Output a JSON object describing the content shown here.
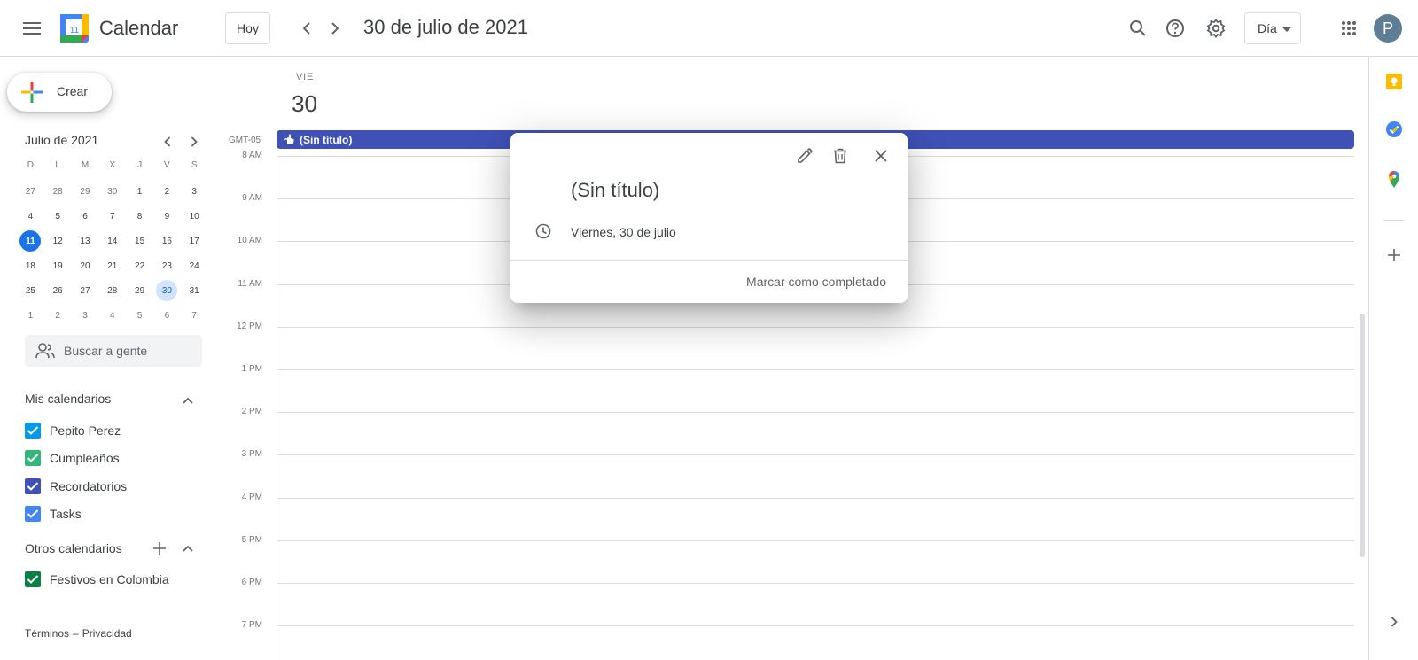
{
  "header": {
    "app_name": "Calendar",
    "logo_day": "11",
    "today_label": "Hoy",
    "date_title": "30 de julio de 2021",
    "view_label": "Día",
    "avatar_letter": "P"
  },
  "sidebar": {
    "create_label": "Crear",
    "mini_calendar": {
      "month_label": "Julio de 2021",
      "weekdays": [
        "D",
        "L",
        "M",
        "X",
        "J",
        "V",
        "S"
      ],
      "weeks": [
        [
          "27",
          "28",
          "29",
          "30",
          "1",
          "2",
          "3"
        ],
        [
          "4",
          "5",
          "6",
          "7",
          "8",
          "9",
          "10"
        ],
        [
          "11",
          "12",
          "13",
          "14",
          "15",
          "16",
          "17"
        ],
        [
          "18",
          "19",
          "20",
          "21",
          "22",
          "23",
          "24"
        ],
        [
          "25",
          "26",
          "27",
          "28",
          "29",
          "30",
          "31"
        ],
        [
          "1",
          "2",
          "3",
          "4",
          "5",
          "6",
          "7"
        ]
      ],
      "today": "11",
      "selected": "30"
    },
    "search_people_placeholder": "Buscar a gente",
    "my_calendars_title": "Mis calendarios",
    "my_calendars": [
      {
        "name": "Pepito Perez",
        "color": "#039be5"
      },
      {
        "name": "Cumpleaños",
        "color": "#33b679"
      },
      {
        "name": "Recordatorios",
        "color": "#3f51b5"
      },
      {
        "name": "Tasks",
        "color": "#4285f4"
      }
    ],
    "other_calendars_title": "Otros calendarios",
    "other_calendars": [
      {
        "name": "Festivos en Colombia",
        "color": "#0b8043"
      }
    ],
    "footer": {
      "terms": "Términos",
      "dash": "–",
      "privacy": "Privacidad"
    }
  },
  "day_view": {
    "day_of_week": "VIE",
    "day_number": "30",
    "timezone": "GMT-05",
    "allday_event": {
      "title": "(Sin título)",
      "color": "#3f51b5"
    },
    "hours": [
      "8 AM",
      "9 AM",
      "10 AM",
      "11 AM",
      "12 PM",
      "1 PM",
      "2 PM",
      "3 PM",
      "4 PM",
      "5 PM",
      "6 PM",
      "7 PM"
    ]
  },
  "popup": {
    "title": "(Sin título)",
    "when": "Viernes, 30 de julio",
    "complete_label": "Marcar como completado"
  }
}
